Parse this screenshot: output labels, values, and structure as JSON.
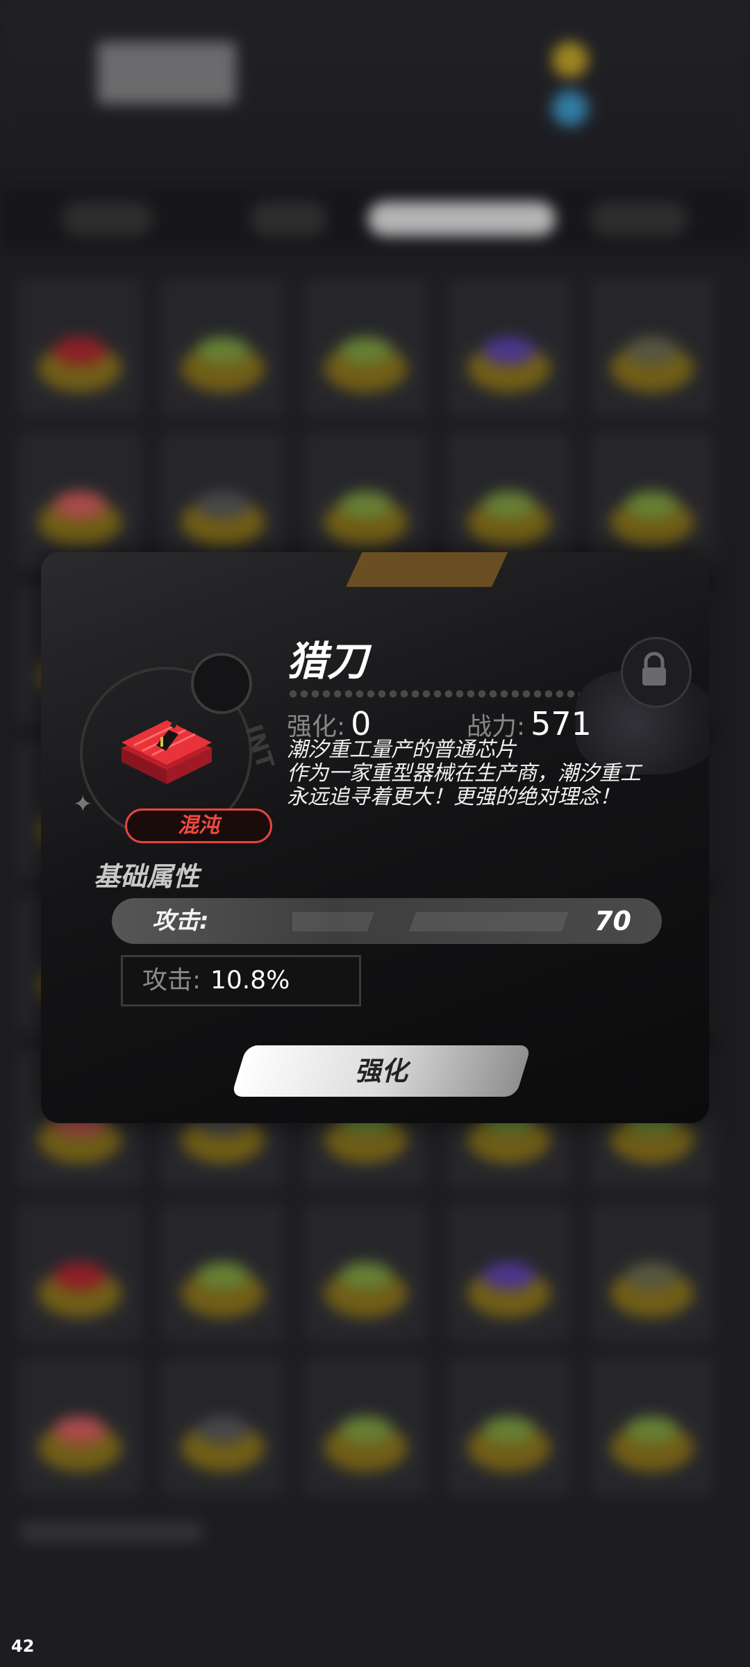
{
  "item": {
    "name": "猎刀",
    "rarity_tag": "混沌",
    "enhance_label": "强化:",
    "enhance_value": "0",
    "power_label": "战力:",
    "power_value": "571",
    "description": [
      "潮汐重工量产的普通芯片",
      "作为一家重型器械在生产商，潮汐重工",
      "永远追寻着更大！更强的绝对理念！"
    ]
  },
  "base_attributes": {
    "title": "基础属性",
    "main_label": "攻击:",
    "main_value": "70"
  },
  "sub_attribute": {
    "label": "攻击:",
    "value": "10.8%"
  },
  "actions": {
    "upgrade_label": "强化"
  },
  "overlay": {
    "fps": "42"
  },
  "icons": {
    "lock": "lock-icon",
    "chip": "chip-icon",
    "sparkle": "sparkle-icon"
  },
  "colors": {
    "rarity": "#e8453f",
    "chip": "#e8333b",
    "dialog_bg": "#141416"
  }
}
